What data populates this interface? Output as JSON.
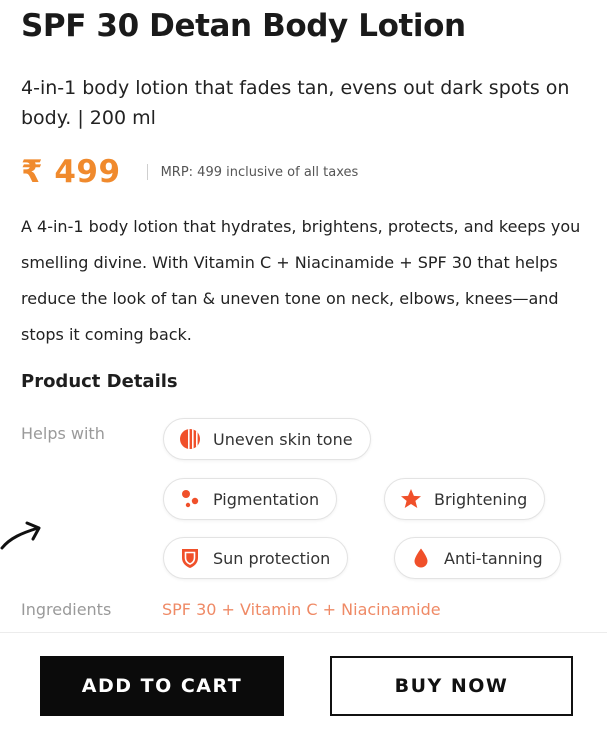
{
  "product": {
    "title": "SPF 30 Detan Body Lotion",
    "subtitle": "4-in-1 body lotion that fades tan, evens out dark spots on body. |  200 ml",
    "price": "₹ 499",
    "mrp_text": "MRP: 499 inclusive of all taxes",
    "description": "A 4-in-1 body lotion that hydrates, brightens, protects, and keeps you smelling divine. With Vitamin C + Niacinamide + SPF 30 that helps reduce the look of tan & uneven tone on neck, elbows, knees—and stops it coming back."
  },
  "details": {
    "section_title": "Product Details",
    "helps_with_label": "Helps with",
    "helps_with": [
      {
        "label": "Uneven skin tone",
        "icon": "striped-circle-icon"
      },
      {
        "label": "Pigmentation",
        "icon": "dots-icon"
      },
      {
        "label": "Brightening",
        "icon": "star-icon"
      },
      {
        "label": "Sun protection",
        "icon": "shield-icon"
      },
      {
        "label": "Anti-tanning",
        "icon": "droplet-icon"
      }
    ],
    "ingredients_label": "Ingredients",
    "ingredients_value": "SPF 30 + Vitamin C + Niacinamide"
  },
  "actions": {
    "add_to_cart": "ADD TO CART",
    "buy_now": "BUY NOW"
  },
  "colors": {
    "accent_orange": "#f08a2d",
    "icon_orange_red": "#f0502a",
    "ingredients_text": "#ef8a66",
    "primary_button": "#0b0b0b"
  }
}
